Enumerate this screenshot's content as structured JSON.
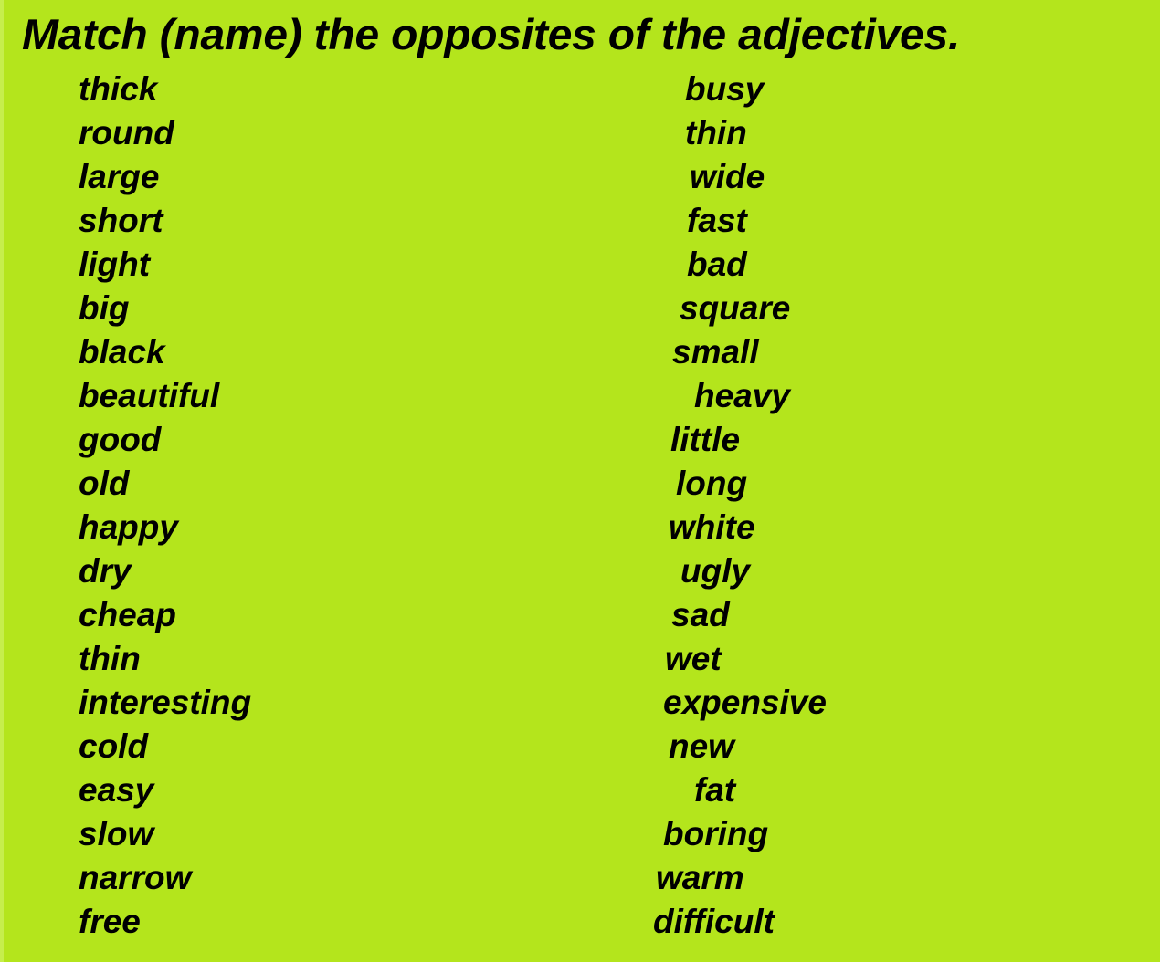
{
  "title": "Match (name) the opposites of the adjectives.",
  "colors": {
    "background": "#b4e51c",
    "edge_strip": "#c6ee4c",
    "text": "#000000"
  },
  "left_column": {
    "name": "adjectives",
    "words": [
      "thick",
      "round",
      "large",
      "short",
      "light",
      "big",
      "black",
      "beautiful",
      "good",
      "old",
      "happy",
      "dry",
      "cheap",
      "thin",
      "interesting",
      "cold",
      "easy",
      "slow",
      "narrow",
      "free"
    ]
  },
  "right_column": {
    "name": "opposites",
    "words": [
      "busy",
      "thin",
      "wide",
      "fast",
      "bad",
      "square",
      "small",
      "heavy",
      "little",
      "long",
      "white",
      "ugly",
      "sad",
      "wet",
      "expensive",
      "new",
      "fat",
      "boring",
      "warm",
      "difficult"
    ],
    "indents": [
      50,
      50,
      55,
      52,
      52,
      44,
      36,
      60,
      34,
      40,
      32,
      45,
      35,
      28,
      26,
      32,
      60,
      26,
      18,
      15
    ]
  }
}
